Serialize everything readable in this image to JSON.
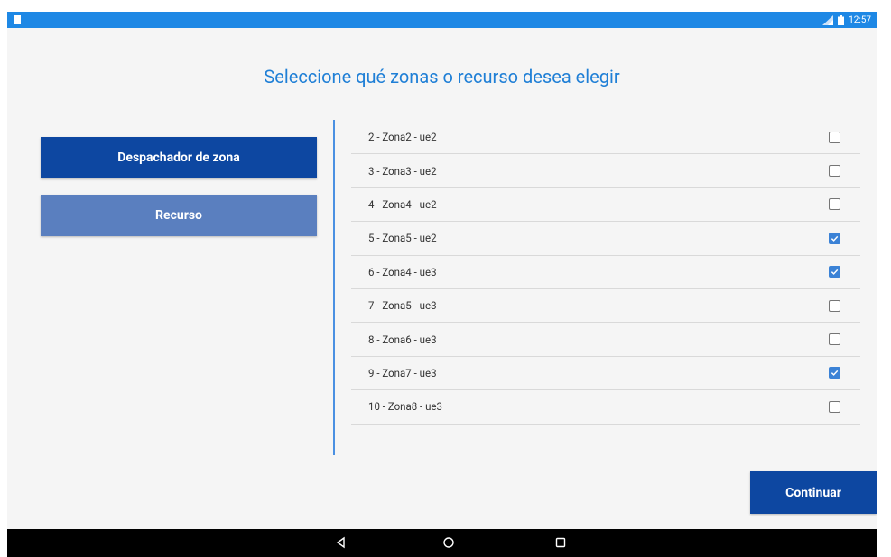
{
  "status": {
    "time": "12:57"
  },
  "title": "Seleccione qué zonas o recurso desea elegir",
  "left_buttons": {
    "primary": "Despachador de zona",
    "secondary": "Recurso"
  },
  "zones": [
    {
      "label": "2 - Zona2 - ue2",
      "checked": false
    },
    {
      "label": "3 - Zona3 - ue2",
      "checked": false
    },
    {
      "label": "4 - Zona4 - ue2",
      "checked": false
    },
    {
      "label": "5 - Zona5 - ue2",
      "checked": true
    },
    {
      "label": "6 - Zona4 - ue3",
      "checked": true
    },
    {
      "label": "7 - Zona5 - ue3",
      "checked": false
    },
    {
      "label": "8 - Zona6 - ue3",
      "checked": false
    },
    {
      "label": "9 - Zona7 - ue3",
      "checked": true
    },
    {
      "label": "10 - Zona8 - ue3",
      "checked": false
    }
  ],
  "continue_label": "Continuar",
  "colors": {
    "status_bar": "#1e88e5",
    "title": "#1f7fd6",
    "primary": "#0d47a1",
    "secondary": "#5a7fbf",
    "checkbox_checked": "#3b82d6"
  },
  "icons": {
    "notification": "sd-card-icon",
    "signal": "signal-icon",
    "battery": "battery-icon",
    "back": "back-triangle-icon",
    "home": "home-circle-icon",
    "recents": "recents-square-icon"
  }
}
